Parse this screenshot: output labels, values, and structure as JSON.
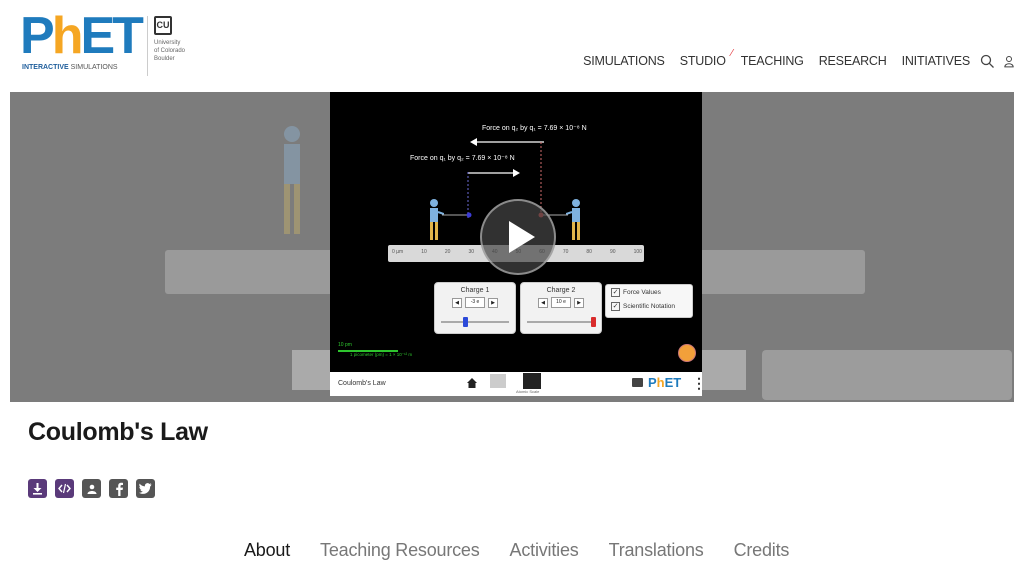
{
  "colors": {
    "phet_blue": "#1f7bbd",
    "phet_orange": "#f5a623",
    "share_purple": "#5a3a7a",
    "share_gray": "#555555",
    "hero_gray": "#7c7c7c",
    "sim_green": "#2ec52e"
  },
  "header": {
    "logo": {
      "letters_p": "P",
      "letters_h": "h",
      "letters_et": "ET",
      "tag_bold": "INTERACTIVE",
      "tag_rest": "SIMULATIONS"
    },
    "cu_logo": {
      "mark": "CU",
      "text": "University\nof Colorado\nBoulder"
    },
    "nav": [
      {
        "label": "SIMULATIONS"
      },
      {
        "label": "STUDIO"
      },
      {
        "label": "TEACHING"
      },
      {
        "label": "RESEARCH"
      },
      {
        "label": "INITIATIVES"
      }
    ],
    "icons": [
      "search-icon",
      "user-icon"
    ]
  },
  "simulation": {
    "force_top": "Force on q₂ by q₁ = 7.69 × 10⁻⁸ N",
    "force_bottom": "Force on q₁ by q₂ = 7.69 × 10⁻⁸ N",
    "ruler_ticks": [
      "0 µm",
      "10",
      "20",
      "30",
      "40",
      "50",
      "60",
      "70",
      "80",
      "90",
      "100"
    ],
    "charge1": {
      "title": "Charge 1",
      "value": "-3 e"
    },
    "charge2": {
      "title": "Charge 2",
      "value": "10 e"
    },
    "checkboxes": [
      {
        "label": "Force Values",
        "checked": true
      },
      {
        "label": "Scientific Notation",
        "checked": true
      }
    ],
    "scale": {
      "label": "10 pm",
      "note": "1 picometer (pm) = 1 × 10⁻¹² m"
    },
    "bar_title": "Coulomb's Law",
    "bar_screen2_label": "Atomic Scale",
    "bar_logo_p": "P",
    "bar_logo_h": "h",
    "bar_logo_et": "ET"
  },
  "page": {
    "title": "Coulomb's Law",
    "share_icons": [
      "download-icon",
      "embed-icon",
      "person-icon",
      "facebook-icon",
      "twitter-icon"
    ],
    "tabs": [
      {
        "label": "About",
        "active": true
      },
      {
        "label": "Teaching Resources",
        "active": false
      },
      {
        "label": "Activities",
        "active": false
      },
      {
        "label": "Translations",
        "active": false
      },
      {
        "label": "Credits",
        "active": false
      }
    ]
  }
}
